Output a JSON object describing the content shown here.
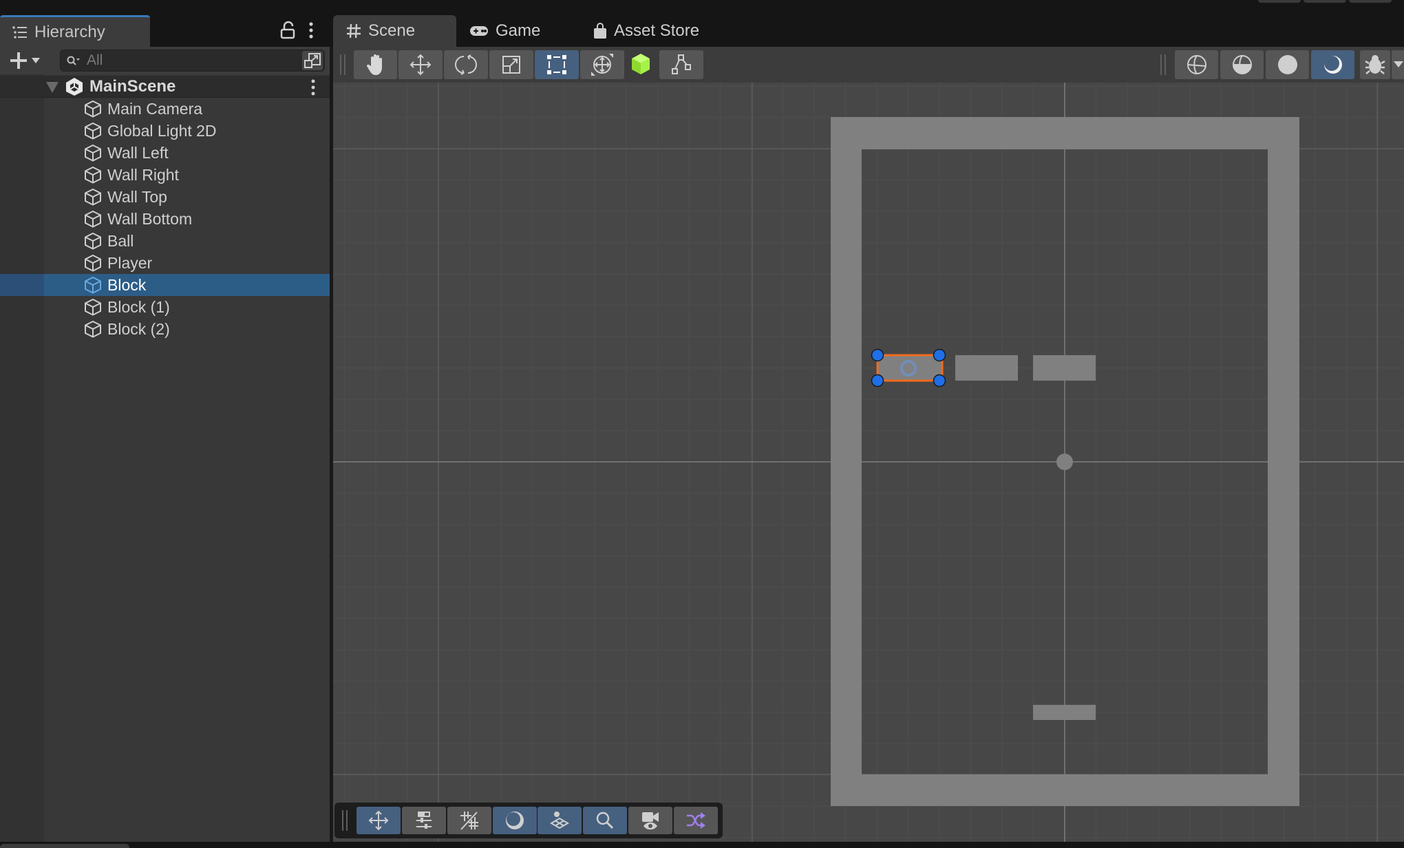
{
  "hierarchy": {
    "tab_label": "Hierarchy",
    "search_placeholder": "All",
    "scene_name": "MainScene",
    "items": [
      {
        "label": "Main Camera",
        "selected": false
      },
      {
        "label": "Global Light 2D",
        "selected": false
      },
      {
        "label": "Wall Left",
        "selected": false
      },
      {
        "label": "Wall Right",
        "selected": false
      },
      {
        "label": "Wall Top",
        "selected": false
      },
      {
        "label": "Wall Bottom",
        "selected": false
      },
      {
        "label": "Ball",
        "selected": false
      },
      {
        "label": "Player",
        "selected": false
      },
      {
        "label": "Block",
        "selected": true
      },
      {
        "label": "Block (1)",
        "selected": false
      },
      {
        "label": "Block (2)",
        "selected": false
      }
    ]
  },
  "tabs": [
    {
      "label": "Scene",
      "icon": "grid-hash-icon",
      "active": true
    },
    {
      "label": "Game",
      "icon": "gamepad-icon",
      "active": false
    },
    {
      "label": "Asset Store",
      "icon": "shopping-bag-icon",
      "active": false
    }
  ],
  "tools": [
    {
      "name": "hand-tool",
      "active": false
    },
    {
      "name": "move-tool",
      "active": false
    },
    {
      "name": "rotate-tool",
      "active": false
    },
    {
      "name": "scale-tool",
      "active": false
    },
    {
      "name": "rect-tool",
      "active": true
    },
    {
      "name": "transform-tool",
      "active": false
    },
    {
      "name": "custom-editor-tool",
      "active": false
    },
    {
      "name": "edit-collider-tool",
      "active": false
    }
  ],
  "view_options": [
    {
      "name": "wireframe-shading",
      "active": false
    },
    {
      "name": "shaded-wireframe",
      "active": false
    },
    {
      "name": "shaded",
      "active": false
    },
    {
      "name": "2d-lighting-toggle",
      "active": true
    },
    {
      "name": "debug-draw-mode",
      "active": false
    }
  ],
  "overlay_toolbar": [
    {
      "name": "view-tool-toggle",
      "active": true
    },
    {
      "name": "draw-mode-options",
      "active": false
    },
    {
      "name": "grid-toggle",
      "active": false
    },
    {
      "name": "lighting-toggle",
      "active": true
    },
    {
      "name": "orientation-toggle",
      "active": true
    },
    {
      "name": "search-toggle",
      "active": true
    },
    {
      "name": "camera-visibility",
      "active": false
    },
    {
      "name": "shuffle-toggle",
      "active": false
    }
  ],
  "colors": {
    "accent": "#3a79bb",
    "selection": "#2c5d87",
    "active_button": "#46607f",
    "sprite": "#808080",
    "selection_outline": "#f26b1d",
    "handle": "#1e6fe8",
    "cube_icon_green": "#a6f24a",
    "shuffle_purple": "#a07ff0"
  }
}
